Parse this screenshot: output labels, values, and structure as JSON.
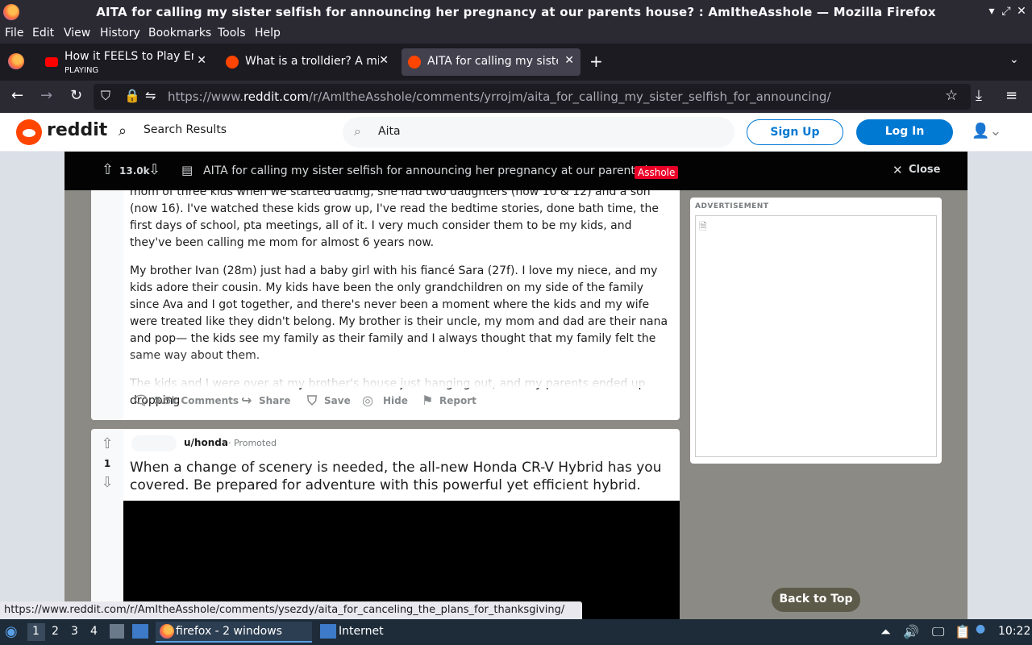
{
  "window": {
    "title": "AITA for calling my sister selfish for announcing her pregnancy at our parents house? : AmItheAsshole — Mozilla Firefox"
  },
  "menu": [
    "File",
    "Edit",
    "View",
    "History",
    "Bookmarks",
    "Tools",
    "Help"
  ],
  "tabs": [
    {
      "label": "How it FEELS to Play Eng",
      "sub": "PLAYING",
      "active": false
    },
    {
      "label": "What is a trolldier? A mis",
      "active": false
    },
    {
      "label": "AITA for calling my sister",
      "active": true
    }
  ],
  "address": {
    "url_prefix": "https://www.",
    "url_domain": "reddit.com",
    "url_path": "/r/AmItheAsshole/comments/yrrojm/aita_for_calling_my_sister_selfish_for_announcing/"
  },
  "reddit_header": {
    "wordmark": "reddit",
    "search_results": "Search Results",
    "search_value": "Aita",
    "signup": "Sign Up",
    "login": "Log In"
  },
  "post_bar": {
    "score": "13.0k",
    "title": "AITA for calling my sister selfish for announcing her pregnancy at our parents ho...",
    "flair": "Asshole",
    "close": "Close"
  },
  "post": {
    "paragraphs": [
      "mom of three kids when we started dating, she had two daughters (now 10 & 12) and a son (now 16). I've watched these kids grow up, I've read the bedtime stories, done bath time, the first days of school, pta meetings, all of it. I very much consider them to be my kids, and they've been calling me mom for almost 6 years now.",
      "My brother Ivan (28m) just had a baby girl with his fiancé Sara (27f). I love my niece, and my kids adore their cousin. My kids have been the only grandchildren on my side of the family since Ava and I got together, and there's never been a moment where the kids and my wife were treated like they didn't belong. My brother is their uncle, my mom and dad are their nana and pop— the kids see my family as their family and I always thought that my family felt the same way about them.",
      "The kids and I were over at my brother's house just hanging out, and my parents ended up dropping"
    ],
    "actions": {
      "comments": "5.5k Comments",
      "share": "Share",
      "save": "Save",
      "hide": "Hide",
      "report": "Report"
    }
  },
  "promoted": {
    "votes": "1",
    "user": "u/honda",
    "promoted_label": "· Promoted",
    "title": "When a change of scenery is needed, the all-new Honda CR-V Hybrid has you covered. Be prepared for adventure with this powerful yet efficient hybrid."
  },
  "ad": {
    "label": "ADVERTISEMENT"
  },
  "back_to_top": "Back to Top",
  "status_url": "https://www.reddit.com/r/AmItheAsshole/comments/ysezdy/aita_for_canceling_the_plans_for_thanksgiving/",
  "taskbar": {
    "workspaces": [
      "1",
      "2",
      "3",
      "4"
    ],
    "firefox": "firefox - 2 windows",
    "internet": "Internet",
    "clock": "10:22"
  }
}
